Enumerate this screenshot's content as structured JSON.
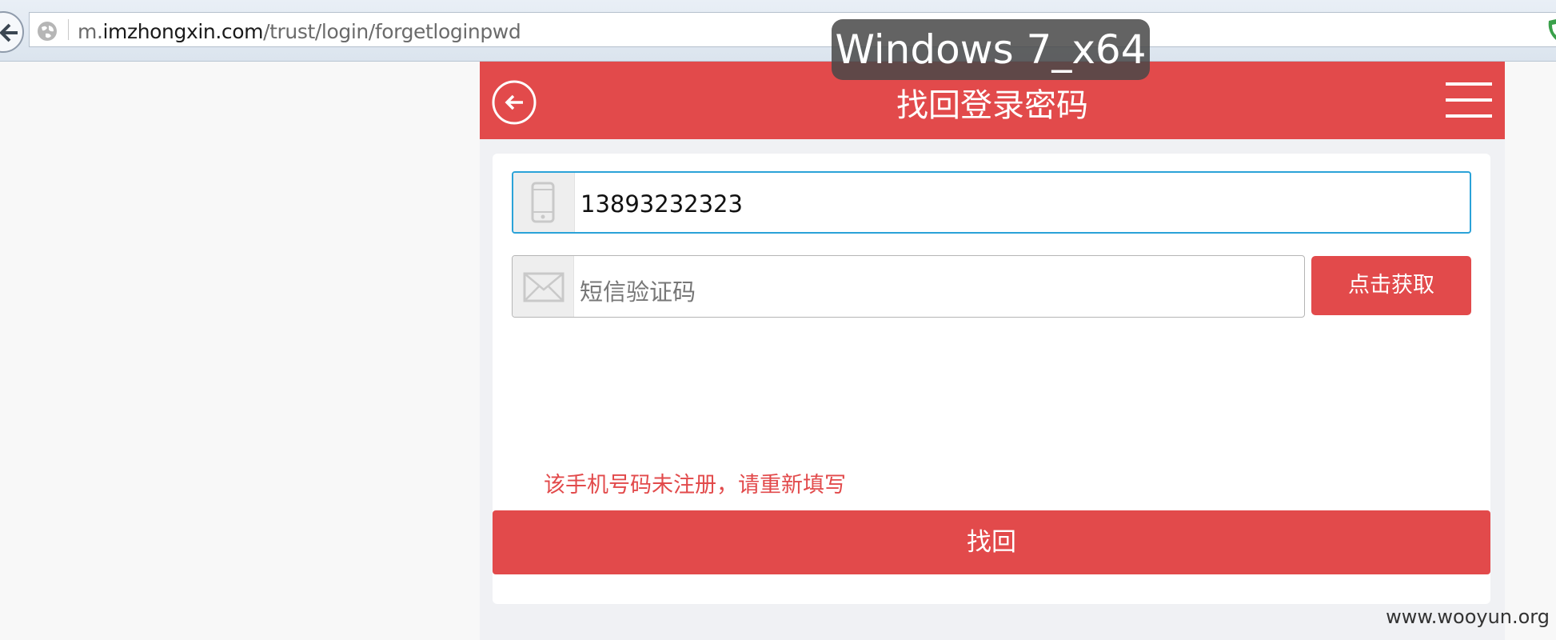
{
  "browser": {
    "url_prefix": "m.",
    "url_domain": "imzhongxin.com",
    "url_path": "/trust/login/forgetloginpwd"
  },
  "overlay": {
    "label": "Windows 7_x64"
  },
  "header": {
    "title": "找回登录密码",
    "back_icon": "circle-arrow-left-icon",
    "menu_icon": "hamburger-menu-icon"
  },
  "form": {
    "phone": {
      "value": "13893232323",
      "icon": "mobile-phone-icon"
    },
    "sms_code": {
      "placeholder": "短信验证码",
      "icon": "envelope-icon"
    },
    "get_code_label": "点击获取",
    "error_message": "该手机号码未注册，请重新填写",
    "submit_label": "找回"
  },
  "watermark": "www.wooyun.org",
  "colors": {
    "brand_red": "#e24a4b",
    "focus_border": "#2aa2d8"
  }
}
